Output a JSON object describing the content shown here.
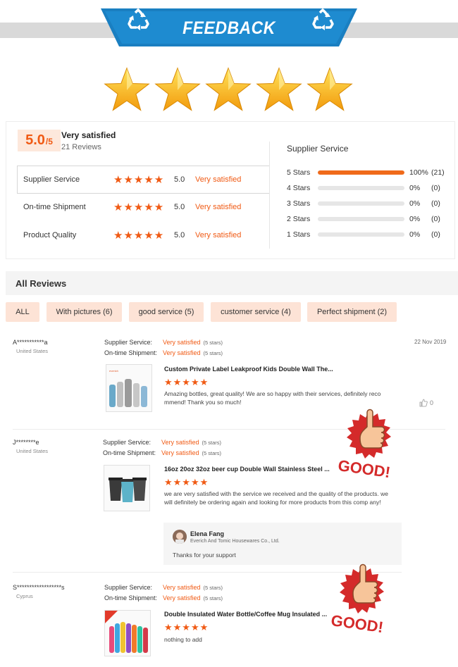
{
  "banner": {
    "title": "FEEDBACK",
    "color": "#1a7fc1",
    "icon": "recycle-icon"
  },
  "summary": {
    "score": "5.0",
    "score_suffix": "/5",
    "title": "Very satisfied",
    "reviews": "21 Reviews",
    "big_stars_count": 5,
    "categories": [
      {
        "label": "Supplier Service",
        "stars": "★★★★★",
        "value": "5.0",
        "text": "Very satisfied"
      },
      {
        "label": "On-time Shipment",
        "stars": "★★★★★",
        "value": "5.0",
        "text": "Very satisfied"
      },
      {
        "label": "Product Quality",
        "stars": "★★★★★",
        "value": "5.0",
        "text": "Very satisfied"
      }
    ],
    "service_title": "Supplier Service",
    "distribution": [
      {
        "label": "5 Stars",
        "percent": 100,
        "percent_text": "100%",
        "count": "(21)"
      },
      {
        "label": "4 Stars",
        "percent": 0,
        "percent_text": "0%",
        "count": "(0)"
      },
      {
        "label": "3 Stars",
        "percent": 0,
        "percent_text": "0%",
        "count": "(0)"
      },
      {
        "label": "2 Stars",
        "percent": 0,
        "percent_text": "0%",
        "count": "(0)"
      },
      {
        "label": "1 Stars",
        "percent": 0,
        "percent_text": "0%",
        "count": "(0)"
      }
    ]
  },
  "all_reviews": {
    "heading": "All Reviews",
    "filters": [
      "ALL",
      "With pictures (6)",
      "good service (5)",
      "customer service (4)",
      "Perfect shipment (2)"
    ]
  },
  "reviews": [
    {
      "name": "A***********a",
      "country": "United States",
      "service_label": "Supplier Service:",
      "service_value": "Very satisfied",
      "service_note": "(5 stars)",
      "shipment_label": "On-time Shipment:",
      "shipment_value": "Very satisfied",
      "shipment_note": "(5 stars)",
      "date": "22 Nov 2019",
      "product": "Custom Private Label Leakproof Kids Double Wall The...",
      "stars": "★★★★★",
      "text": "Amazing bottles, great quality! We are so happy with their services, definitely reco mmend! Thank you so much!",
      "likes": "0"
    },
    {
      "name": "J********e",
      "country": "United States",
      "service_label": "Supplier Service:",
      "service_value": "Very satisfied",
      "service_note": "(5 stars)",
      "shipment_label": "On-time Shipment:",
      "shipment_value": "Very satisfied",
      "shipment_note": "(5 stars)",
      "product": "16oz 20oz 32oz beer cup Double Wall Stainless Steel ...",
      "stars": "★★★★★",
      "text": "we are very satisfied with the service we received and the quality of the products. we will definitely be ordering again and looking for more products from this comp any!",
      "reply": {
        "name": "Elena Fang",
        "company": "Everich And Tomic Housewares Co., Ltd.",
        "text": "Thanks for your support"
      }
    },
    {
      "name": "S******************s",
      "country": "Cyprus",
      "service_label": "Supplier Service:",
      "service_value": "Very satisfied",
      "service_note": "(5 stars)",
      "shipment_label": "On-time Shipment:",
      "shipment_value": "Very satisfied",
      "shipment_note": "(5 stars)",
      "product": "Double Insulated Water Bottle/Coffee Mug Insulated ...",
      "stars": "★★★★★",
      "text": "nothing to add"
    }
  ],
  "stickers": {
    "text": "GOOD!",
    "color": "#d42a2a"
  },
  "colors": {
    "accent": "#f05a14",
    "chip": "#fde3d6",
    "star_gold": "#ffc20e"
  }
}
